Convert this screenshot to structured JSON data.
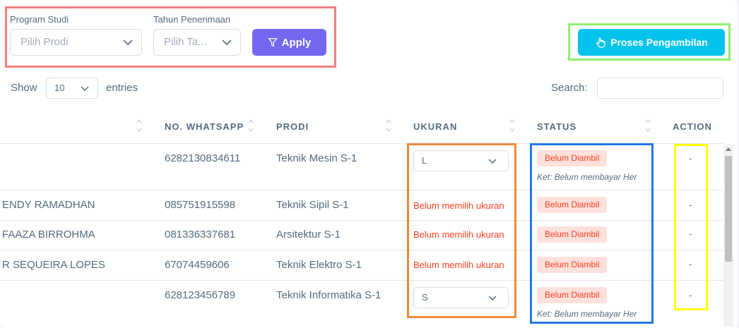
{
  "filters": {
    "prodi_label": "Program Studi",
    "prodi_placeholder": "Pilih Prodi",
    "tahun_label": "Tahun Penerimaan",
    "tahun_placeholder": "Pilih Ta...",
    "apply_label": "Apply",
    "proses_label": "Proses Pengambilan"
  },
  "table_controls": {
    "show_label": "Show",
    "entries_value": "10",
    "entries_label": "entries",
    "search_label": "Search:"
  },
  "columns": {
    "whatsapp": "NO. WHATSAPP",
    "prodi": "PRODI",
    "ukuran": "UKURAN",
    "status": "STATUS",
    "action": "ACTION"
  },
  "rows": [
    {
      "name": "",
      "whatsapp": "6282130834611",
      "prodi": "Teknik Mesin S-1",
      "ukuran": "L",
      "ukuran_warning": "",
      "status": "Belum Diambil",
      "ket": "Ket: Belum membayar Her",
      "action": "-"
    },
    {
      "name": "ENDY RAMADHAN",
      "whatsapp": "085751915598",
      "prodi": "Teknik Sipil S-1",
      "ukuran": "",
      "ukuran_warning": "Belum memilih ukuran",
      "status": "Belum Diambil",
      "ket": "",
      "action": "-"
    },
    {
      "name": "FAAZA BIRROHMA",
      "whatsapp": "081336337681",
      "prodi": "Arsitektur S-1",
      "ukuran": "",
      "ukuran_warning": "Belum memilih ukuran",
      "status": "Belum Diambil",
      "ket": "",
      "action": "-"
    },
    {
      "name": "R SEQUEIRA LOPES",
      "whatsapp": "67074459606",
      "prodi": "Teknik Elektro S-1",
      "ukuran": "",
      "ukuran_warning": "Belum memilih ukuran",
      "status": "Belum Diambil",
      "ket": "",
      "action": "-"
    },
    {
      "name": "",
      "whatsapp": "628123456789",
      "prodi": "Teknik Informatika S-1",
      "ukuran": "S",
      "ukuran_warning": "",
      "status": "Belum Diambil",
      "ket": "Ket: Belum membayar Her",
      "action": "-"
    }
  ],
  "colors": {
    "apply_button": "#7367f0",
    "proses_button": "#03c3ec",
    "badge_bg": "#ffe0db",
    "badge_text": "#ff3e1d",
    "highlight_filters": "#f08080",
    "highlight_proses": "#90ee70",
    "highlight_ukuran": "#f0883c",
    "highlight_status": "#1e78e6",
    "highlight_action": "#ffff00"
  },
  "icons": {
    "filter": "filter-icon",
    "hand": "hand-pointer-icon",
    "chevron": "chevron-down-icon",
    "sort": "sort-icon"
  }
}
